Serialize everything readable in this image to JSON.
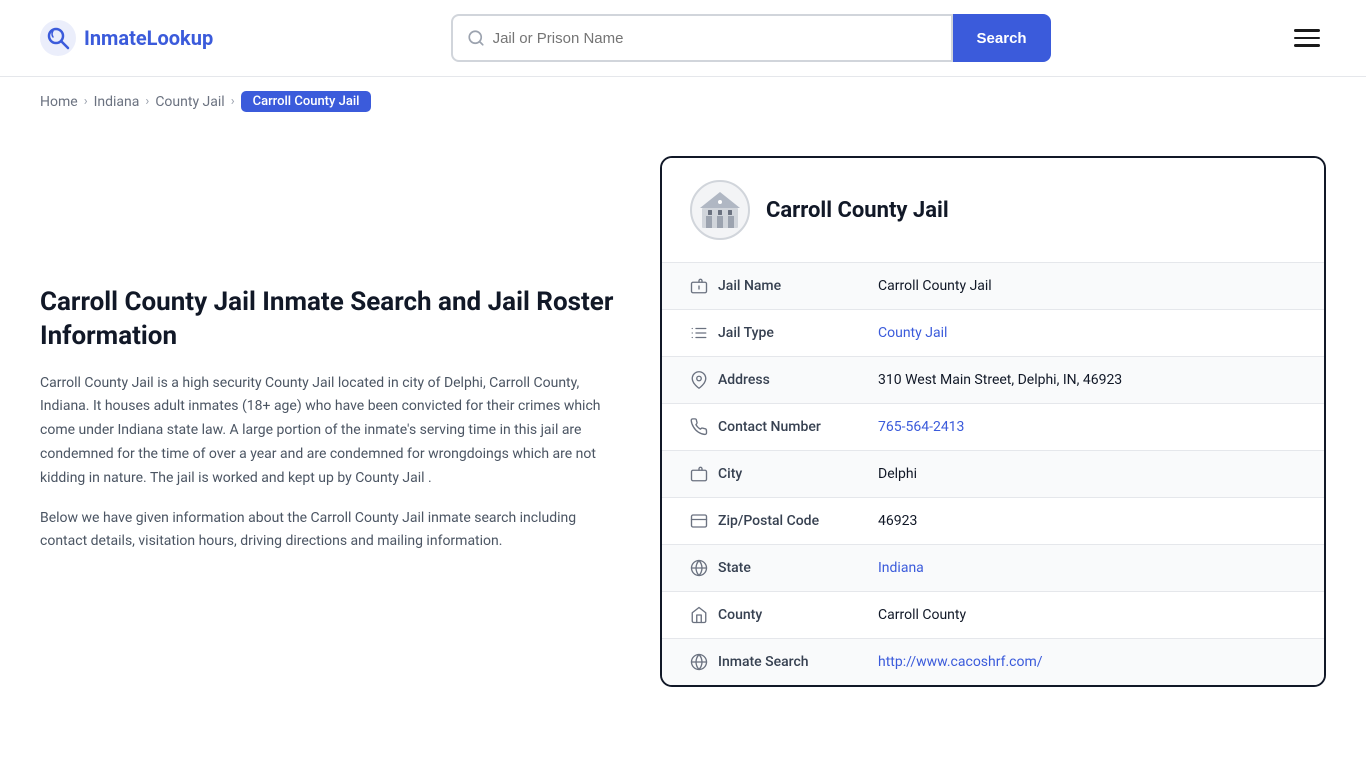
{
  "site": {
    "logo_text_part1": "Inmate",
    "logo_text_part2": "Lookup"
  },
  "header": {
    "search_placeholder": "Jail or Prison Name",
    "search_button_label": "Search"
  },
  "breadcrumb": {
    "items": [
      {
        "label": "Home",
        "href": "#"
      },
      {
        "label": "Indiana",
        "href": "#"
      },
      {
        "label": "County Jail",
        "href": "#"
      },
      {
        "label": "Carroll County Jail",
        "active": true
      }
    ]
  },
  "left": {
    "page_title": "Carroll County Jail Inmate Search and Jail Roster Information",
    "description1": "Carroll County Jail is a high security County Jail located in city of Delphi, Carroll County, Indiana. It houses adult inmates (18+ age) who have been convicted for their crimes which come under Indiana state law. A large portion of the inmate's serving time in this jail are condemned for the time of over a year and are condemned for wrongdoings which are not kidding in nature. The jail is worked and kept up by County Jail .",
    "description2": "Below we have given information about the Carroll County Jail inmate search including contact details, visitation hours, driving directions and mailing information."
  },
  "card": {
    "title": "Carroll County Jail",
    "rows": [
      {
        "icon": "jail-icon",
        "label": "Jail Name",
        "value": "Carroll County Jail",
        "link": false
      },
      {
        "icon": "list-icon",
        "label": "Jail Type",
        "value": "County Jail",
        "link": true,
        "href": "#"
      },
      {
        "icon": "location-icon",
        "label": "Address",
        "value": "310 West Main Street, Delphi, IN, 46923",
        "link": false
      },
      {
        "icon": "phone-icon",
        "label": "Contact Number",
        "value": "765-564-2413",
        "link": true,
        "href": "tel:765-564-2413"
      },
      {
        "icon": "city-icon",
        "label": "City",
        "value": "Delphi",
        "link": false
      },
      {
        "icon": "zip-icon",
        "label": "Zip/Postal Code",
        "value": "46923",
        "link": false
      },
      {
        "icon": "globe-icon",
        "label": "State",
        "value": "Indiana",
        "link": true,
        "href": "#"
      },
      {
        "icon": "county-icon",
        "label": "County",
        "value": "Carroll County",
        "link": false
      },
      {
        "icon": "search-globe-icon",
        "label": "Inmate Search",
        "value": "http://www.cacoshrf.com/",
        "link": true,
        "href": "http://www.cacoshrf.com/"
      }
    ]
  }
}
